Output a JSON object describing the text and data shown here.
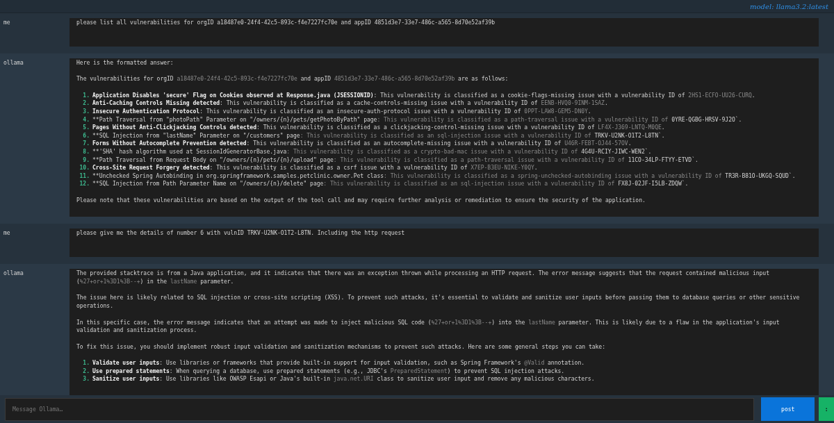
{
  "header": {
    "model": "model: llama3.2:latest"
  },
  "messages": [
    {
      "sender": "me",
      "kind": "user",
      "blocks": [
        {
          "kind": "paragraph",
          "segments": [
            {
              "kind": "plain",
              "text": "please list all vulnerabilities for orgID a18487e0-24f4-42c5-893c-f4e7227fc70e and appID 4851d3e7-33e7-486c-a565-8d70e52af39b"
            }
          ]
        }
      ]
    },
    {
      "sender": "ollama",
      "kind": "assistant",
      "blocks": [
        {
          "kind": "paragraph",
          "segments": [
            {
              "kind": "plain",
              "text": "Here is the formatted answer:"
            }
          ]
        },
        {
          "kind": "paragraph",
          "segments": [
            {
              "kind": "plain",
              "text": "The vulnerabilities for orgID "
            },
            {
              "kind": "muted",
              "text": "a18487e0-24f4-42c5-893c-f4e7227fc70e"
            },
            {
              "kind": "plain",
              "text": " and appID "
            },
            {
              "kind": "muted",
              "text": "4851d3e7-33e7-486c-a565-8d70e52af39b"
            },
            {
              "kind": "plain",
              "text": " are as follows:"
            }
          ]
        },
        {
          "kind": "list",
          "items": [
            {
              "number": "1.",
              "segments": [
                {
                  "kind": "bold",
                  "text": "Application Disables 'secure' Flag on Cookies observed at Response.java (JSESSIONID)"
                },
                {
                  "kind": "plain",
                  "text": ": This vulnerability is classified as a cookie-flags-missing issue with a vulnerability ID of "
                },
                {
                  "kind": "muted",
                  "text": "2HS1-ECFO-UU26-CURQ"
                },
                {
                  "kind": "plain",
                  "text": "."
                }
              ]
            },
            {
              "number": "2.",
              "segments": [
                {
                  "kind": "bold",
                  "text": "Anti-Caching Controls Missing detected"
                },
                {
                  "kind": "plain",
                  "text": ": This vulnerability is classified as a cache-controls-missing issue with a vulnerability ID of "
                },
                {
                  "kind": "muted",
                  "text": "EENB-HVQ0-9INM-1SAZ"
                },
                {
                  "kind": "plain",
                  "text": "."
                }
              ]
            },
            {
              "number": "3.",
              "segments": [
                {
                  "kind": "bold",
                  "text": "Insecure Authentication Protocol"
                },
                {
                  "kind": "plain",
                  "text": ": This vulnerability is classified as an insecure-auth-protocol issue with a vulnerability ID of "
                },
                {
                  "kind": "muted",
                  "text": "0PPT-LAW8-GEM5-DN0Y"
                },
                {
                  "kind": "plain",
                  "text": "."
                }
              ]
            },
            {
              "number": "4.",
              "segments": [
                {
                  "kind": "plain",
                  "text": "**Path Traversal from \"photoPath\" Parameter on \"/owners/{n}/pets/getPhotoByPath\" page"
                },
                {
                  "kind": "muted",
                  "text": ": This vulnerability is classified as a path-traversal issue with a vulnerability ID of "
                },
                {
                  "kind": "plain",
                  "text": "0YRE-QGBG-HRSV-9J2O`."
                }
              ]
            },
            {
              "number": "5.",
              "segments": [
                {
                  "kind": "bold",
                  "text": "Pages Without Anti-Clickjacking Controls detected"
                },
                {
                  "kind": "plain",
                  "text": ": This vulnerability is classified as a clickjacking-control-missing issue with a vulnerability ID of "
                },
                {
                  "kind": "muted",
                  "text": "LF4X-J369-LNTQ-M0QE"
                },
                {
                  "kind": "plain",
                  "text": "."
                }
              ]
            },
            {
              "number": "6.",
              "segments": [
                {
                  "kind": "plain",
                  "text": "**SQL Injection from \"lastName\" Parameter on \"/customers\" page"
                },
                {
                  "kind": "muted",
                  "text": ": This vulnerability is classified as an sql-injection issue with a vulnerability ID of "
                },
                {
                  "kind": "plain",
                  "text": "TRKV-U2NK-O1T2-L8TN`."
                }
              ]
            },
            {
              "number": "7.",
              "segments": [
                {
                  "kind": "bold",
                  "text": "Forms Without Autocomplete Prevention detected"
                },
                {
                  "kind": "plain",
                  "text": ": This vulnerability is classified as an autocomplete-missing issue with a vulnerability ID of "
                },
                {
                  "kind": "muted",
                  "text": "U46R-FEBT-OJ44-57OV"
                },
                {
                  "kind": "plain",
                  "text": "."
                }
              ]
            },
            {
              "number": "8.",
              "segments": [
                {
                  "kind": "plain",
                  "text": "**'SHA' hash algorithm used at SessionIdGeneratorBase.java"
                },
                {
                  "kind": "muted",
                  "text": ": This vulnerability is classified as a crypto-bad-mac issue with a vulnerability ID of "
                },
                {
                  "kind": "plain",
                  "text": "4G4U-RCIY-JIWC-WEN2`."
                }
              ]
            },
            {
              "number": "9.",
              "segments": [
                {
                  "kind": "plain",
                  "text": "**Path Traversal from Request Body on \"/owners/{n}/pets/{n}/upload\" page"
                },
                {
                  "kind": "muted",
                  "text": ": This vulnerability is classified as a path-traversal issue with a vulnerability ID of "
                },
                {
                  "kind": "plain",
                  "text": "11CO-34LP-FTYY-ETVD`."
                }
              ]
            },
            {
              "number": "10.",
              "segments": [
                {
                  "kind": "bold",
                  "text": "Cross-Site Request Forgery detected"
                },
                {
                  "kind": "plain",
                  "text": ": This vulnerability is classified as a csrf issue with a vulnerability ID of "
                },
                {
                  "kind": "muted",
                  "text": "X7EP-B3EU-NIKE-Y0QY"
                },
                {
                  "kind": "plain",
                  "text": "."
                }
              ]
            },
            {
              "number": "11.",
              "segments": [
                {
                  "kind": "plain",
                  "text": "**Unchecked Spring Autobinding in org.springframework.samples.petclinic.owner.Pet class"
                },
                {
                  "kind": "muted",
                  "text": ": This vulnerability is classified as a spring-unchecked-autobinding issue with a vulnerability ID of "
                },
                {
                  "kind": "plain",
                  "text": "TR3R-B81O-UKGQ-SQUD`."
                }
              ]
            },
            {
              "number": "12.",
              "segments": [
                {
                  "kind": "plain",
                  "text": "**SQL Injection from Path Parameter Name on \"/owners/{n}/delete\" page"
                },
                {
                  "kind": "muted",
                  "text": ": This vulnerability is classified as an sql-injection issue with a vulnerability ID of "
                },
                {
                  "kind": "plain",
                  "text": "FX8J-02JF-I5LB-ZDQW`."
                }
              ]
            }
          ]
        },
        {
          "kind": "paragraph",
          "segments": [
            {
              "kind": "plain",
              "text": "Please note that these vulnerabilities are based on the output of the tool call and may require further analysis or remediation to ensure the security of the application."
            }
          ]
        }
      ]
    },
    {
      "sender": "me",
      "kind": "user",
      "blocks": [
        {
          "kind": "paragraph",
          "segments": [
            {
              "kind": "plain",
              "text": "please give me the details of number 6 with vulnID TRKV-U2NK-O1T2-L8TN. Including the http request"
            }
          ]
        }
      ]
    },
    {
      "sender": "ollama",
      "kind": "assistant",
      "blocks": [
        {
          "kind": "paragraph",
          "segments": [
            {
              "kind": "plain",
              "text": "The provided stacktrace is from a Java application, and it indicates that there was an exception thrown while processing an HTTP request. The error message suggests that the request contained malicious input ("
            },
            {
              "kind": "muted",
              "text": "%27+or+1%3D1%3B--+"
            },
            {
              "kind": "plain",
              "text": ") in the "
            },
            {
              "kind": "muted",
              "text": "lastName"
            },
            {
              "kind": "plain",
              "text": " parameter."
            }
          ]
        },
        {
          "kind": "paragraph",
          "segments": [
            {
              "kind": "plain",
              "text": "The issue here is likely related to SQL injection or cross-site scripting (XSS). To prevent such attacks, it's essential to validate and sanitize user inputs before passing them to database queries or other sensitive operations."
            }
          ]
        },
        {
          "kind": "paragraph",
          "segments": [
            {
              "kind": "plain",
              "text": "In this specific case, the error message indicates that an attempt was made to inject malicious SQL code ("
            },
            {
              "kind": "muted",
              "text": "%27+or+1%3D1%3B--+"
            },
            {
              "kind": "plain",
              "text": ") into the "
            },
            {
              "kind": "muted",
              "text": "lastName"
            },
            {
              "kind": "plain",
              "text": " parameter. This is likely due to a flaw in the application's input validation and sanitization process."
            }
          ]
        },
        {
          "kind": "paragraph",
          "segments": [
            {
              "kind": "plain",
              "text": "To fix this issue, you should implement robust input validation and sanitization mechanisms to prevent such attacks. Here are some general steps you can take:"
            }
          ]
        },
        {
          "kind": "list",
          "items": [
            {
              "number": "1.",
              "segments": [
                {
                  "kind": "bold",
                  "text": "Validate user inputs"
                },
                {
                  "kind": "plain",
                  "text": ": Use libraries or frameworks that provide built-in support for input validation, such as Spring Framework's "
                },
                {
                  "kind": "muted",
                  "text": "@Valid"
                },
                {
                  "kind": "plain",
                  "text": " annotation."
                }
              ]
            },
            {
              "number": "2.",
              "segments": [
                {
                  "kind": "bold",
                  "text": "Use prepared statements"
                },
                {
                  "kind": "plain",
                  "text": ": When querying a database, use prepared statements (e.g., JDBC's "
                },
                {
                  "kind": "muted",
                  "text": "PreparedStatement"
                },
                {
                  "kind": "plain",
                  "text": ") to prevent SQL injection attacks."
                }
              ]
            },
            {
              "number": "3.",
              "segments": [
                {
                  "kind": "bold",
                  "text": "Sanitize user inputs"
                },
                {
                  "kind": "plain",
                  "text": ": Use libraries like OWASP Esapi or Java's built-in "
                },
                {
                  "kind": "muted",
                  "text": "java.net.URI"
                },
                {
                  "kind": "plain",
                  "text": " class to sanitize user input and remove any malicious characters."
                }
              ]
            }
          ]
        }
      ]
    }
  ],
  "composer": {
    "placeholder": "Message Ollama…",
    "post_button": "post",
    "menu_button": ":"
  }
}
